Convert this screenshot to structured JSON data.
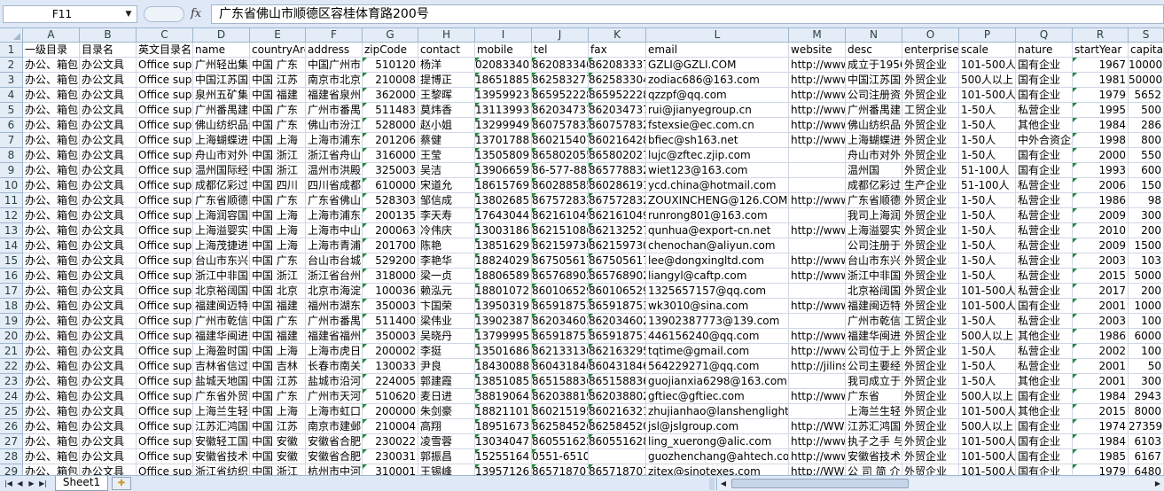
{
  "formula_bar": {
    "name_box": "F11",
    "fx_label": "fx",
    "formula": "广东省佛山市顺德区容桂体育路200号"
  },
  "columns": [
    "A",
    "B",
    "C",
    "D",
    "E",
    "F",
    "G",
    "H",
    "I",
    "J",
    "K",
    "L",
    "M",
    "N",
    "O",
    "P",
    "Q",
    "R",
    "S"
  ],
  "rows": [
    [
      "一级目录",
      "目录名",
      "英文目录名",
      "name",
      "countryArea",
      "address",
      "zipCode",
      "contact",
      "mobile",
      "tel",
      "fax",
      "email",
      "website",
      "desc",
      "enterpriseType",
      "scale",
      "nature",
      "startYear",
      "capital"
    ],
    [
      "办公、箱包",
      "办公文具",
      "Office supplies",
      "广州轻出集团",
      "中国 广东",
      "中国广州市",
      "510120",
      "杨洋",
      "02083340",
      "862083340",
      "862083337",
      "GZLI@GZLI.COM",
      "http://www",
      "成立于1956",
      "外贸企业",
      "101-500人",
      "国有企业",
      "1967",
      "10000"
    ],
    [
      "办公、箱包",
      "办公文具",
      "Office supplies",
      "中国江苏国际",
      "中国 江苏",
      "南京市北京",
      "210008",
      "提博正",
      "18651885",
      "862583277",
      "862583304",
      "zodiac686@163.com",
      "http://www",
      "中国江苏国",
      "外贸企业",
      "500人以上",
      "国有企业",
      "1981",
      "50000"
    ],
    [
      "办公、箱包",
      "办公文具",
      "Office supplies",
      "泉州五矿集团",
      "中国 福建",
      "福建省泉州",
      "362000",
      "王黎晖",
      "13959923",
      "865952228",
      "865952228",
      "qzzpf@qq.com",
      "http://www",
      "公司注册资",
      "外贸企业",
      "101-500人",
      "国有企业",
      "1979",
      "5652"
    ],
    [
      "办公、箱包",
      "办公文具",
      "Office supplies",
      "广州番禺建业",
      "中国 广东",
      "广州市番禺",
      "511483",
      "莫炜香",
      "13113993",
      "862034737",
      "862034737",
      "rui@jianyegroup.cn",
      "http://www",
      "广州番禺建",
      "工贸企业",
      "1-50人",
      "私营企业",
      "1995",
      "500"
    ],
    [
      "办公、箱包",
      "办公文具",
      "Office supplies",
      "佛山纺织品进",
      "中国 广东",
      "佛山市汾江",
      "528000",
      "赵小姐",
      "13299949",
      "860757832",
      "860757832",
      "fstexsie@ec.com.cn",
      "http://www",
      "佛山纺织品",
      "外贸企业",
      "1-50人",
      "其他企业",
      "1984",
      "286"
    ],
    [
      "办公、箱包",
      "办公文具",
      "Office supplies",
      "上海蝴蝶进出",
      "中国 上海",
      "上海市浦东",
      "201206",
      "蔡健",
      "13701788",
      "860215407",
      "860216428",
      "bfiec@sh163.net",
      "http://www",
      "上海蝴蝶进",
      "外贸企业",
      "1-50人",
      "中外合资企业",
      "1998",
      "800"
    ],
    [
      "办公、箱包",
      "办公文具",
      "Office supplies",
      "舟山市对外",
      "中国 浙江",
      "浙江省舟山",
      "316000",
      "王莹",
      "13505809",
      "865802055",
      "865802027",
      "lujc@zftec.zjip.com",
      "",
      "舟山市对外",
      "外贸企业",
      "1-50人",
      "国有企业",
      "2000",
      "550"
    ],
    [
      "办公、箱包",
      "办公文具",
      "Office supplies",
      "温州国际经济",
      "中国 浙江",
      "温州市洪殿",
      "325003",
      "吴洁",
      "13906659",
      "86-577-883",
      "865778832",
      "wiet123@163.com",
      "",
      "温州国",
      "外贸企业",
      "51-100人",
      "国有企业",
      "1993",
      "600"
    ],
    [
      "办公、箱包",
      "办公文具",
      "Office supplies",
      "成都亿彩过",
      "中国 四川",
      "四川省成都",
      "610000",
      "宋道允",
      "18615769",
      "860288585",
      "860286191",
      "ycd.china@hotmail.com",
      "",
      "成都亿彩过",
      "生产企业",
      "51-100人",
      "私营企业",
      "2006",
      "150"
    ],
    [
      "办公、箱包",
      "办公文具",
      "Office supplies",
      "广东省顺德",
      "中国 广东",
      "广东省佛山",
      "528303",
      "邹信成",
      "13802685",
      "867572832",
      "867572832",
      "ZOUXINCHENG@126.COM",
      "http://www",
      "广东省顺德",
      "外贸企业",
      "1-50人",
      "私营企业",
      "1986",
      "98"
    ],
    [
      "办公、箱包",
      "办公文具",
      "Office supplies",
      "上海润容国",
      "中国 上海",
      "上海市浦东",
      "200135",
      "李天寿",
      "17643044",
      "862161049",
      "862161049",
      "runrong801@163.com",
      "",
      "我司上海润",
      "外贸企业",
      "1-50人",
      "私营企业",
      "2009",
      "300"
    ],
    [
      "办公、箱包",
      "办公文具",
      "Office supplies",
      "上海溢婴实业",
      "中国 上海",
      "上海市中山",
      "200063",
      "冷伟庆",
      "13003186",
      "862151086",
      "862132527",
      "qunhua@export-cn.net",
      "http://www",
      "上海溢婴实",
      "外贸企业",
      "1-50人",
      "私营企业",
      "2010",
      "200"
    ],
    [
      "办公、箱包",
      "办公文具",
      "Office supplies",
      "上海茂捷进",
      "中国 上海",
      "上海市青浦",
      "201700",
      "陈艳",
      "13851629",
      "862159730",
      "862159730",
      "chenochan@aliyun.com",
      "",
      "公司注册于",
      "外贸企业",
      "1-50人",
      "私营企业",
      "2009",
      "1500"
    ],
    [
      "办公、箱包",
      "办公文具",
      "Office supplies",
      "台山市东兴",
      "中国 广东",
      "台山市台城",
      "529200",
      "李艳华",
      "18824029",
      "867505617",
      "867505617",
      "lee@dongxingltd.com",
      "http://www",
      "台山市东兴",
      "外贸企业",
      "1-50人",
      "私营企业",
      "2003",
      "103"
    ],
    [
      "办公、箱包",
      "办公文具",
      "Office supplies",
      "浙江中非国",
      "中国 浙江",
      "浙江省台州",
      "318000",
      "梁一贞",
      "18806589",
      "865768902",
      "865768902",
      "liangyl@caftp.com",
      "http://www",
      "浙江中非国",
      "外贸企业",
      "1-50人",
      "私营企业",
      "2015",
      "5000"
    ],
    [
      "办公、箱包",
      "办公文具",
      "Office supplies",
      "北京裕阔国",
      "中国 北京",
      "北京市海淀",
      "100036",
      "赖泓元",
      "18801072",
      "860106529",
      "860106529",
      "1325657157@qq.com",
      "",
      "北京裕阔国",
      "外贸企业",
      "101-500人",
      "私营企业",
      "2017",
      "200"
    ],
    [
      "办公、箱包",
      "办公文具",
      "Office supplies",
      "福建闽迈特",
      "中国 福建",
      "福州市湖东",
      "350003",
      "卞国荣",
      "13950319",
      "865918753",
      "865918753",
      "wk3010@sina.com",
      "http://www",
      "福建闽迈特",
      "外贸企业",
      "101-500人",
      "国有企业",
      "2001",
      "1000"
    ],
    [
      "办公、箱包",
      "办公文具",
      "Office supplies",
      "广州市乾信",
      "中国 广东",
      "广州市番禺",
      "511400",
      "梁伟业",
      "13902387",
      "862034603",
      "862034602",
      "13902387773@139.com",
      "",
      "广州市乾信",
      "工贸企业",
      "1-50人",
      "私营企业",
      "2003",
      "100"
    ],
    [
      "办公、箱包",
      "办公文具",
      "Office supplies",
      "福建华闽进",
      "中国 福建",
      "福建省福州",
      "350003",
      "吴晓丹",
      "13799995",
      "865918751",
      "865918751",
      "446156240@qq.com",
      "http://www",
      "福建华闽进",
      "外贸企业",
      "500人以上",
      "其他企业",
      "1986",
      "6000"
    ],
    [
      "办公、箱包",
      "办公文具",
      "Office supplies",
      "上海盈时国",
      "中国 上海",
      "上海市虎日",
      "200002",
      "李挺",
      "13501686",
      "862133130",
      "862163295",
      "tqtime@gmail.com",
      "http://www",
      "公司位于上",
      "外贸企业",
      "1-50人",
      "私营企业",
      "2002",
      "100"
    ],
    [
      "办公、箱包",
      "办公文具",
      "Office supplies",
      "吉林省信过",
      "中国 吉林",
      "长春市南关",
      "130033",
      "尹良",
      "18430088",
      "860431846",
      "860431846",
      "564229271@qq.com",
      "http://jilins",
      "公司主要经",
      "外贸企业",
      "1-50人",
      "私营企业",
      "2001",
      "50"
    ],
    [
      "办公、箱包",
      "办公文具",
      "Office supplies",
      "盐城天地国",
      "中国 江苏",
      "盐城市沿河",
      "224005",
      "郭建霞",
      "13851085",
      "865158836",
      "865158836",
      "guojianxia6298@163.com",
      "",
      "我司成立于",
      "外贸企业",
      "1-50人",
      "其他企业",
      "2001",
      "300"
    ],
    [
      "办公、箱包",
      "办公文具",
      "Office supplies",
      "广东省外贸",
      "中国 广东",
      "广州市天河",
      "510620",
      "麦日进",
      "38819064",
      "862038819",
      "862038802",
      "gftiec@gftiec.com",
      "http://www",
      "广东省",
      "外贸企业",
      "500人以上",
      "国有企业",
      "1984",
      "2943"
    ],
    [
      "办公、箱包",
      "办公文具",
      "Office supplies",
      "上海兰生轻",
      "中国 上海",
      "上海市虹口",
      "200000",
      "朱剑豪",
      "18821101",
      "860215195",
      "860216321",
      "zhujianhao@lanshenglight.com",
      "",
      "上海兰生轻",
      "外贸企业",
      "101-500人",
      "其他企业",
      "2015",
      "8000"
    ],
    [
      "办公、箱包",
      "办公文具",
      "Office supplies",
      "江苏汇鸿国",
      "中国 江苏",
      "南京市建邺",
      "210004",
      "高翔",
      "18951673",
      "862584526",
      "862584520",
      "jsl@jslgroup.com",
      "http://WW",
      "江苏汇鸿国",
      "外贸企业",
      "500人以上",
      "国有企业",
      "1974",
      "27359"
    ],
    [
      "办公、箱包",
      "办公文具",
      "Office supplies",
      "安徽轻工国",
      "中国 安徽",
      "安徽省合肥",
      "230022",
      "凌雪蓉",
      "13034047",
      "860551622",
      "860551628",
      "ling_xuerong@alic.com",
      "http://www",
      "执子之手 与",
      "外贸企业",
      "101-500人",
      "国有企业",
      "1984",
      "6103"
    ],
    [
      "办公、箱包",
      "办公文具",
      "Office supplies",
      "安徽省技术",
      "中国 安徽",
      "安徽省合肥",
      "230031",
      "郭振昌",
      "15255164",
      "0551-65101015",
      "",
      "guozhenchang@ahtech.com",
      "http://www",
      "安徽省技术",
      "外贸企业",
      "101-500人",
      "国有企业",
      "1985",
      "6167"
    ],
    [
      "办公、箱包",
      "办公文具",
      "Office supplies",
      "浙江省纺织",
      "中国 浙江",
      "杭州市中河",
      "310001",
      "王锡峰",
      "13957126",
      "865718707",
      "865718707",
      "zitex@sinotexes.com",
      "http://WW",
      "公 司 简 介",
      "外贸企业",
      "101-500人",
      "国有企业",
      "1979",
      "6480"
    ]
  ],
  "sheet_tabs": {
    "active": "Sheet1"
  }
}
